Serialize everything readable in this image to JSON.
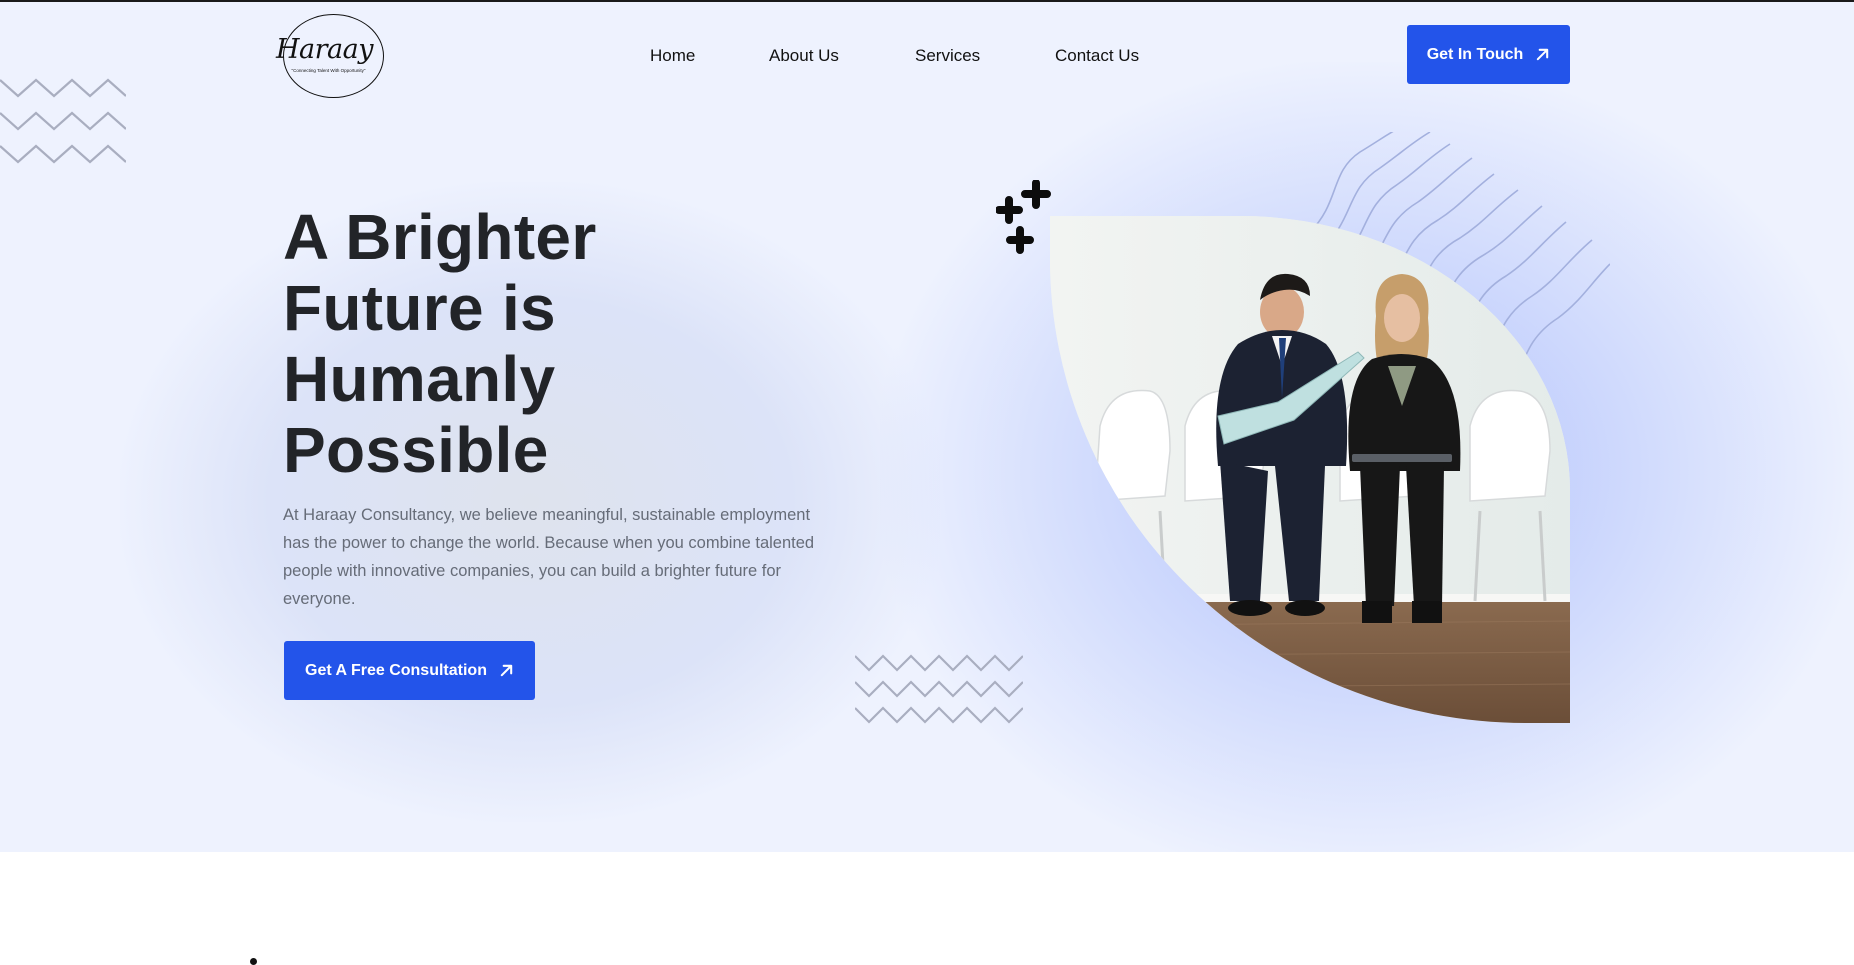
{
  "header": {
    "logo": {
      "name": "Haraay",
      "tagline": "\"Connecting Talent With Opportunity\""
    },
    "nav": [
      {
        "label": "Home"
      },
      {
        "label": "About Us"
      },
      {
        "label": "Services"
      },
      {
        "label": "Contact Us"
      }
    ],
    "cta_label": "Get In Touch"
  },
  "hero": {
    "title_lines": [
      "A Brighter",
      "Future is",
      "Humanly",
      "Possible"
    ],
    "lead": "At Haraay Consultancy, we believe meaningful, sustainable employment has the power to change the world. Because when you combine talented people with innovative companies, you can build a brighter future for everyone.",
    "cta_label": "Get A Free Consultation"
  },
  "icons": {
    "cta_arrow": "arrow-up-right-icon",
    "sparkle": "plus-sparkle-icon"
  },
  "colors": {
    "accent": "#2354ea",
    "hero_bg": "#eef2fe",
    "heading": "#222428",
    "body_text": "#666c78"
  }
}
